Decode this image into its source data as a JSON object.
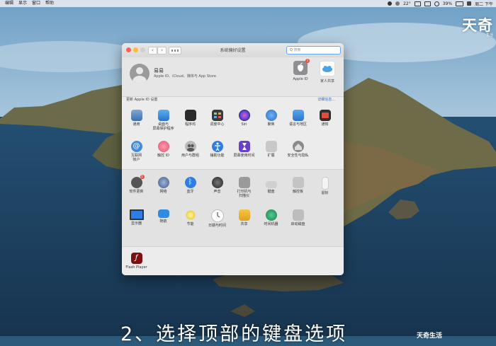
{
  "menubar": {
    "items": [
      "编辑",
      "显示",
      "窗口",
      "帮助"
    ],
    "temperature": "22°",
    "battery": "39%",
    "clock": "周二 下午"
  },
  "watermark": {
    "text": "天奇",
    "sub": "生活"
  },
  "window": {
    "title": "系统偏好设置",
    "search_placeholder": "搜索",
    "account": {
      "name": "易易",
      "subtitle": "Apple ID、iCloud、媒体与 App Store",
      "apple_id_label": "Apple ID",
      "apple_id_badge": "1",
      "family_label": "家人共享"
    },
    "update_label": "更新 Apple ID 设置",
    "details_link": "详细信息...",
    "row1": [
      "通用",
      "桌面与\n屏幕保护程序",
      "程序坞",
      "调度中心",
      "Siri",
      "聚焦",
      "语言与地区",
      "通知"
    ],
    "row2": [
      "互联网\n帐户",
      "触控 ID",
      "用户与群组",
      "辅助功能",
      "屏幕使用时间",
      "扩展",
      "安全性与隐私"
    ],
    "row3": [
      "软件更新",
      "网络",
      "蓝牙",
      "声音",
      "打印机与\n扫描仪",
      "键盘",
      "触控板",
      "鼠标"
    ],
    "row4": [
      "显示器",
      "随航",
      "节能",
      "日期与时间",
      "共享",
      "时间机器",
      "启动磁盘"
    ],
    "row5": [
      "Flash Player"
    ],
    "software_update_badge": "1"
  },
  "caption": "2、选择顶部的键盘选项",
  "corner_logo": "天奇生活",
  "colors": {
    "accent": "#2a6fd1",
    "badge": "#f24a3d"
  }
}
